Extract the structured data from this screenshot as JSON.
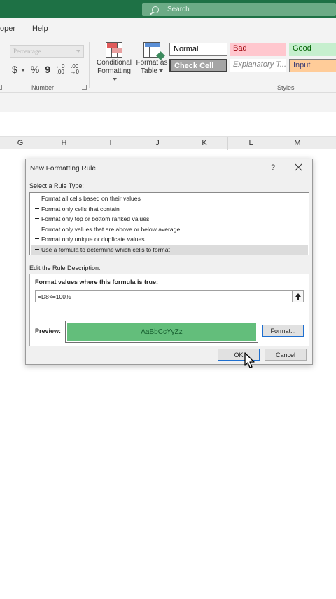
{
  "titlebar": {
    "search_placeholder": "Search",
    "color": "#1e7145"
  },
  "menu": {
    "items": [
      "oper",
      "Help"
    ]
  },
  "ribbon": {
    "number_format_value": "Percentage",
    "number_icons": [
      "$",
      "%",
      "9"
    ],
    "increase_decimal": "←0\n.00",
    "decrease_decimal": ".00\n→0",
    "number_group_label": "Number",
    "conditional_formatting": {
      "line1": "Conditional",
      "line2": "Formatting"
    },
    "format_as_table": {
      "line1": "Format as",
      "line2": "Table"
    },
    "styles_group_label": "Styles",
    "styles": [
      {
        "name": "normal",
        "label": "Normal",
        "bg": "#ffffff",
        "fg": "#000000"
      },
      {
        "name": "bad",
        "label": "Bad",
        "bg": "#ffc7ce",
        "fg": "#9c0006"
      },
      {
        "name": "good",
        "label": "Good",
        "bg": "#c6efce",
        "fg": "#006100"
      },
      {
        "name": "check-cell",
        "label": "Check Cell",
        "bg": "#a5a5a5",
        "fg": "#ffffff"
      },
      {
        "name": "explanatory",
        "label": "Explanatory T...",
        "bg": "#ffffff",
        "fg": "#7f7f7f"
      },
      {
        "name": "input",
        "label": "Input",
        "bg": "#ffcc99",
        "fg": "#3f3f76"
      }
    ]
  },
  "columns": [
    "G",
    "H",
    "I",
    "J",
    "K",
    "L",
    "M"
  ],
  "dialog": {
    "title": "New Formatting Rule",
    "help": "?",
    "select_rule_type_label": "Select a Rule Type:",
    "rule_types": [
      "Format all cells based on their values",
      "Format only cells that contain",
      "Format only top or bottom ranked values",
      "Format only values that are above or below average",
      "Format only unique or duplicate values",
      "Use a formula to determine which cells to format"
    ],
    "selected_rule_index": 5,
    "edit_rule_label": "Edit the Rule Description:",
    "formula_label": "Format values where this formula is true:",
    "formula_value": "=D8<=100%",
    "preview_label": "Preview:",
    "preview_text": "AaBbCcYyZz",
    "preview_fill": "#63be7b",
    "format_button": "Format...",
    "ok_button": "OK",
    "cancel_button": "Cancel"
  }
}
